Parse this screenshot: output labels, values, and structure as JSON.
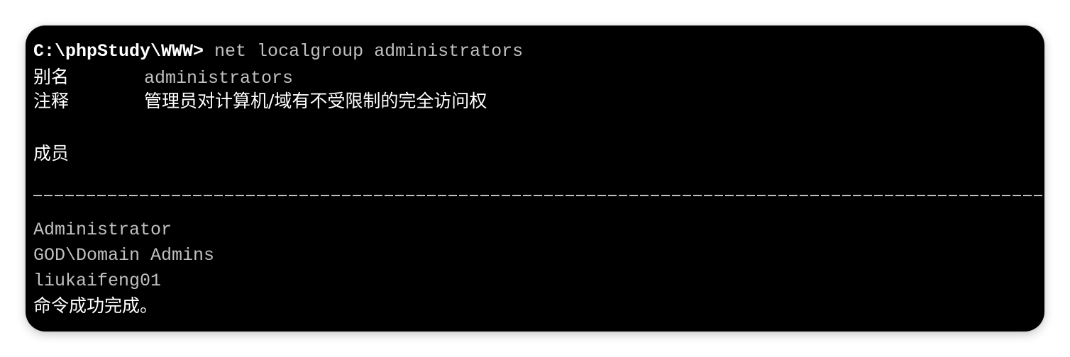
{
  "terminal": {
    "prompt": "C:\\phpStudy\\WWW>",
    "command": " net localgroup administrators",
    "alias_label": "别名",
    "alias_value": "administrators",
    "comment_label": "注释",
    "comment_value": "管理员对计算机/域有不受限制的完全访问权",
    "members_label": "成员",
    "members": [
      "Administrator",
      "GOD\\Domain Admins",
      "liukaifeng01"
    ],
    "completion": "命令成功完成。"
  },
  "colors": {
    "background": "#000000",
    "prompt_text": "#ffffff",
    "output_text": "#c0c0c0"
  }
}
